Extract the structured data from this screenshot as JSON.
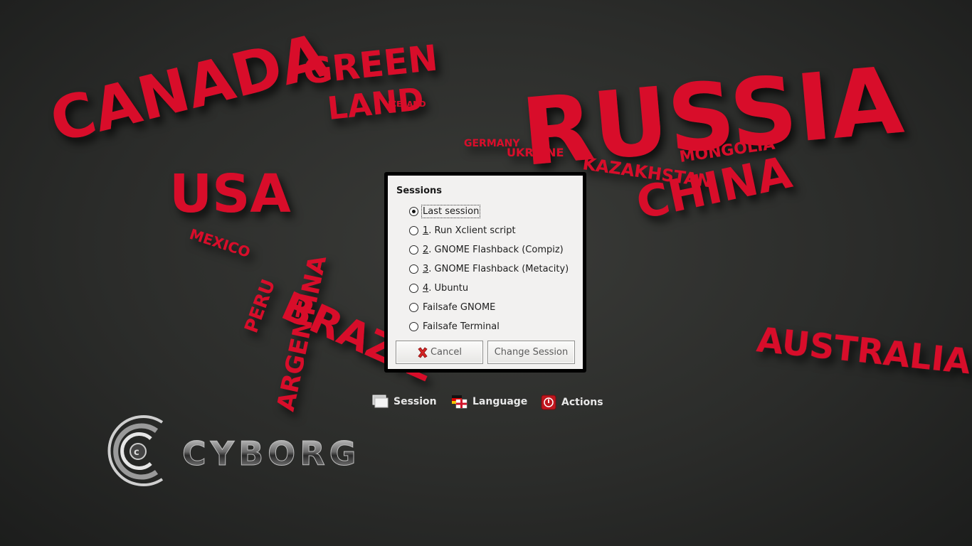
{
  "map": {
    "labels": [
      "GREEN",
      "LAND",
      "ICELAND",
      "CANADA",
      "USA",
      "MEXICO",
      "BRAZIL",
      "PERU",
      "ARGENTINA",
      "RUSSIA",
      "KAZAKHSTAN",
      "MONGOLIA",
      "CHINA",
      "GERMANY",
      "UKRAINE",
      "AUSTRALIA"
    ],
    "color": "#d8102c"
  },
  "dialog": {
    "title": "Sessions",
    "options": [
      {
        "mnemonic": "",
        "label": "Last session",
        "checked": true
      },
      {
        "mnemonic": "1",
        "label": ". Run Xclient script",
        "checked": false
      },
      {
        "mnemonic": "2",
        "label": ". GNOME Flashback (Compiz)",
        "checked": false
      },
      {
        "mnemonic": "3",
        "label": ". GNOME Flashback (Metacity)",
        "checked": false
      },
      {
        "mnemonic": "4",
        "label": ". Ubuntu",
        "checked": false
      },
      {
        "mnemonic": "",
        "label": "Failsafe GNOME",
        "checked": false
      },
      {
        "mnemonic": "",
        "label": "Failsafe Terminal",
        "checked": false
      }
    ],
    "cancel_label": "Cancel",
    "change_label": "Change Session"
  },
  "bottom_bar": {
    "session_label": "Session",
    "language_label": "Language",
    "actions_label": "Actions"
  },
  "brand": {
    "name": "CYBORG",
    "icon": "cyborg-logo-icon"
  }
}
